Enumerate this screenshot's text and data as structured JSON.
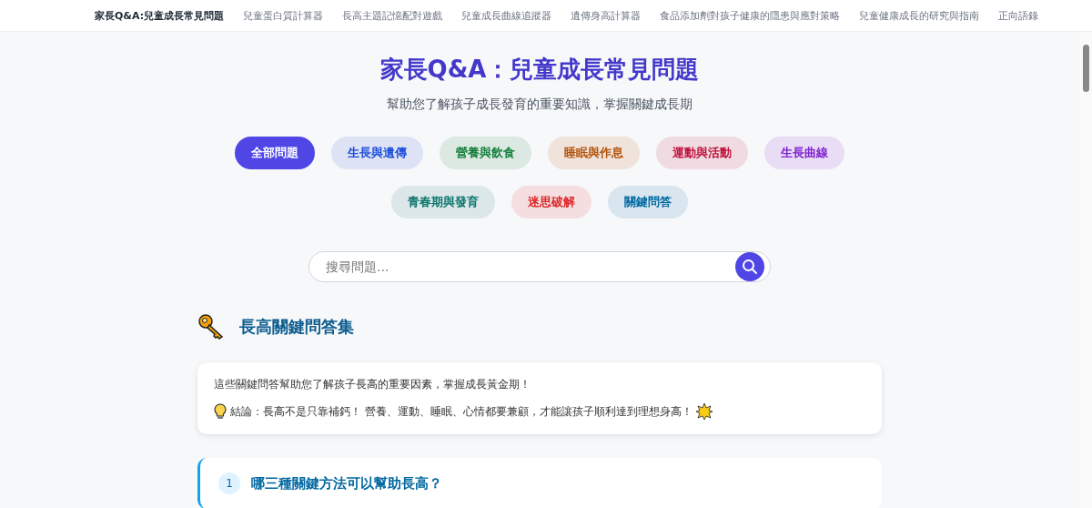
{
  "nav": {
    "items": [
      {
        "label": "家長Q&A:兒童成長常見問題",
        "selected": true
      },
      {
        "label": "兒童蛋白質計算器",
        "selected": false
      },
      {
        "label": "長高主題記憶配對遊戲",
        "selected": false
      },
      {
        "label": "兒童成長曲線追蹤器",
        "selected": false
      },
      {
        "label": "遺傳身高計算器",
        "selected": false
      },
      {
        "label": "食品添加劑對孩子健康的隱患與應對策略",
        "selected": false
      },
      {
        "label": "兒童健康成長的研究與指南",
        "selected": false
      },
      {
        "label": "正向語錄",
        "selected": false
      }
    ]
  },
  "header": {
    "title": "家長Q&A：兒童成長常見問題",
    "subtitle": "幫助您了解孩子成長發育的重要知識，掌握關鍵成長期"
  },
  "filters": [
    {
      "label": "全部問題",
      "selected": true,
      "color": "#4f46e5"
    },
    {
      "label": "生長與遺傳",
      "selected": false,
      "color": "#1d4ed8"
    },
    {
      "label": "營養與飲食",
      "selected": false,
      "color": "#15803d"
    },
    {
      "label": "睡眠與作息",
      "selected": false,
      "color": "#b45309"
    },
    {
      "label": "運動與活動",
      "selected": false,
      "color": "#be123c"
    },
    {
      "label": "生長曲線",
      "selected": false,
      "color": "#7e22ce"
    },
    {
      "label": "青春期與發育",
      "selected": false,
      "color": "#0f766e"
    },
    {
      "label": "迷思破解",
      "selected": false,
      "color": "#dc2626"
    },
    {
      "label": "關鍵問答",
      "selected": false,
      "color": "#0369a1"
    }
  ],
  "search": {
    "placeholder": "搜尋問題..."
  },
  "section": {
    "title": "長高關鍵問答集",
    "intro": "這些關鍵問答幫助您了解孩子長高的重要因素，掌握成長黃金期！",
    "conclusion": "結論：長高不是只靠補鈣！ 營養、運動、睡眠、心情都要兼顧，才能讓孩子順利達到理想身高！"
  },
  "questions": [
    {
      "number": "1",
      "question": "哪三種關鍵方法可以幫助長高？"
    }
  ]
}
